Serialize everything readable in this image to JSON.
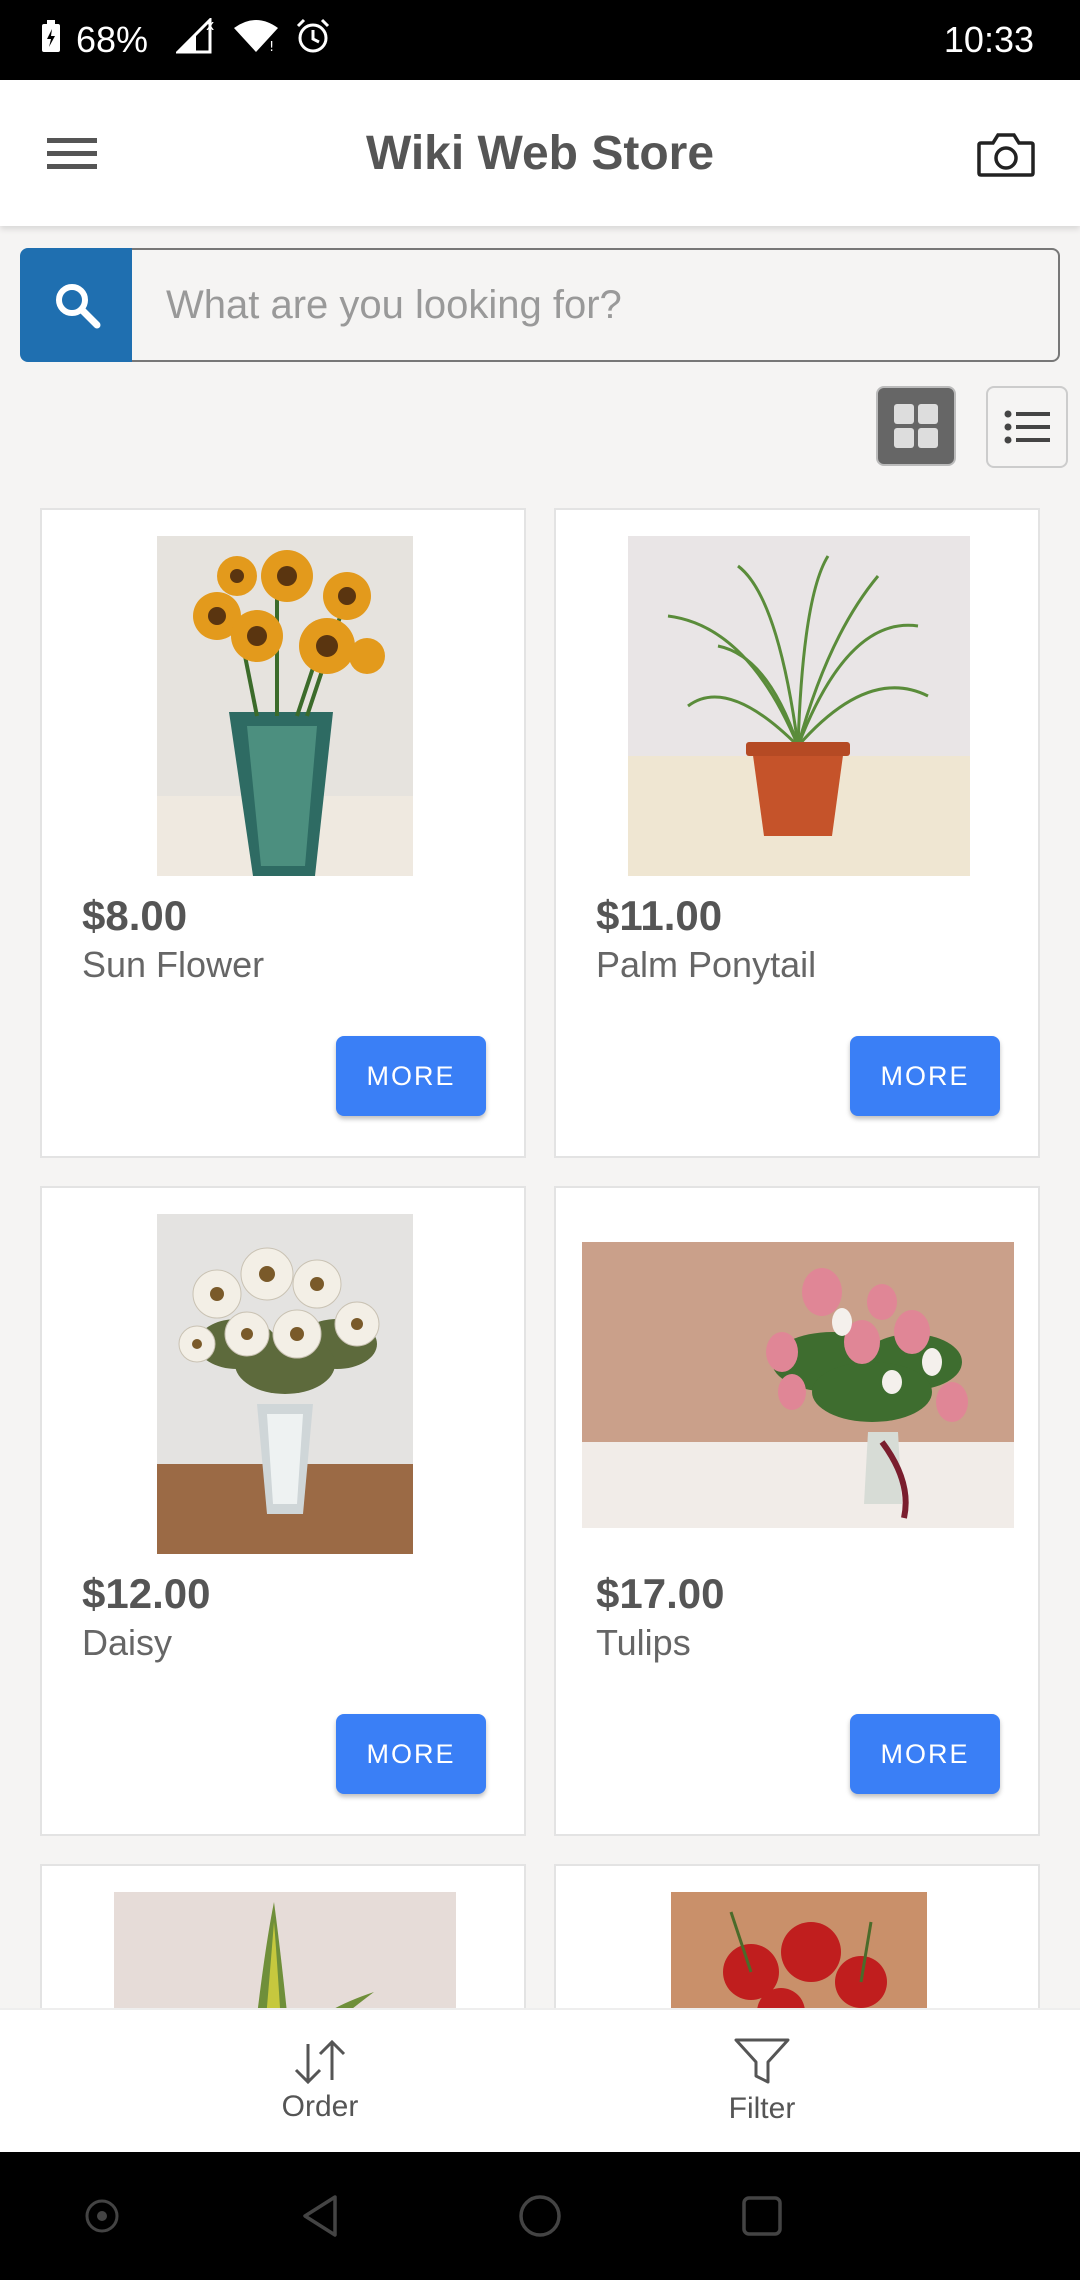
{
  "status_bar": {
    "battery": "68%",
    "time": "10:33"
  },
  "app_bar": {
    "title": "Wiki Web Store",
    "menu_icon": "hamburger-menu-icon",
    "camera_icon": "camera-icon"
  },
  "search": {
    "placeholder": "What are you looking for?",
    "value": ""
  },
  "view_toggle": {
    "selected": "grid"
  },
  "products": [
    {
      "price": "$8.00",
      "name": "Sun Flower",
      "more_label": "MORE"
    },
    {
      "price": "$11.00",
      "name": "Palm Ponytail",
      "more_label": "MORE"
    },
    {
      "price": "$12.00",
      "name": "Daisy",
      "more_label": "MORE"
    },
    {
      "price": "$17.00",
      "name": "Tulips",
      "more_label": "MORE"
    }
  ],
  "bottom_bar": {
    "order_label": "Order",
    "filter_label": "Filter"
  },
  "colors": {
    "accent_button": "#3a7ff6",
    "search_button": "#1f6fb0"
  }
}
